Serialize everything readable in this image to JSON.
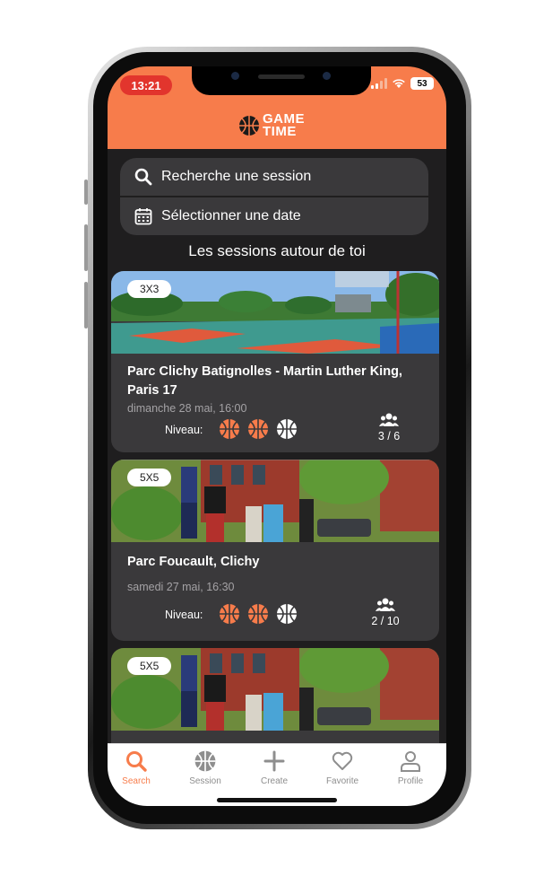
{
  "status_bar": {
    "time": "13:21",
    "battery": "53"
  },
  "brand": {
    "logo_line1": "GAME",
    "logo_line2": "TIME"
  },
  "search": {
    "session_placeholder": "Recherche une session",
    "date_placeholder": "Sélectionner une date"
  },
  "section_title": "Les sessions autour de toi",
  "level_label": "Niveau:",
  "sessions": [
    {
      "type": "3X3",
      "place": "Parc Clichy Batignolles - Martin Luther King, Paris 17",
      "date": "dimanche 28 mai, 16:00",
      "level": 2,
      "players": "3 / 6"
    },
    {
      "type": "5X5",
      "place": "Parc Foucault, Clichy",
      "date": "samedi 27 mai, 16:30",
      "level": 2,
      "players": "2 / 10"
    },
    {
      "type": "5X5"
    }
  ],
  "tabs": [
    {
      "label": "Search",
      "icon": "search-icon",
      "active": true
    },
    {
      "label": "Session",
      "icon": "basketball-icon"
    },
    {
      "label": "Create",
      "icon": "plus-icon"
    },
    {
      "label": "Favorite",
      "icon": "heart-icon"
    },
    {
      "label": "Profile",
      "icon": "user-icon"
    }
  ],
  "colors": {
    "accent": "#f77c4b",
    "background": "#1f1e1f",
    "card": "#3a393b",
    "text_muted": "#a4a2a5"
  }
}
